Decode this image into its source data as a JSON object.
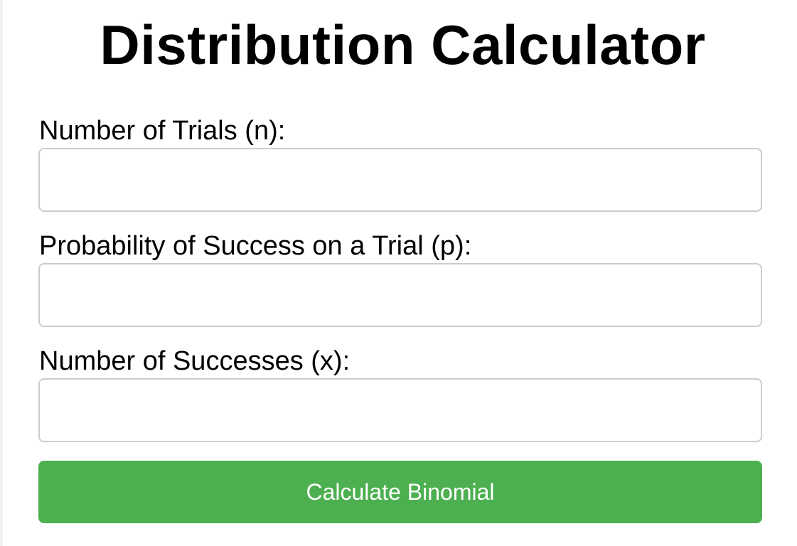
{
  "page": {
    "title": "Distribution Calculator"
  },
  "form": {
    "fields": [
      {
        "label": "Number of Trials (n):",
        "value": "",
        "placeholder": ""
      },
      {
        "label": "Probability of Success on a Trial (p):",
        "value": "",
        "placeholder": ""
      },
      {
        "label": "Number of Successes (x):",
        "value": "",
        "placeholder": ""
      }
    ],
    "submit_label": "Calculate Binomial"
  },
  "colors": {
    "button_bg": "#4caf50",
    "button_text": "#ffffff",
    "input_border": "#cccccc"
  }
}
